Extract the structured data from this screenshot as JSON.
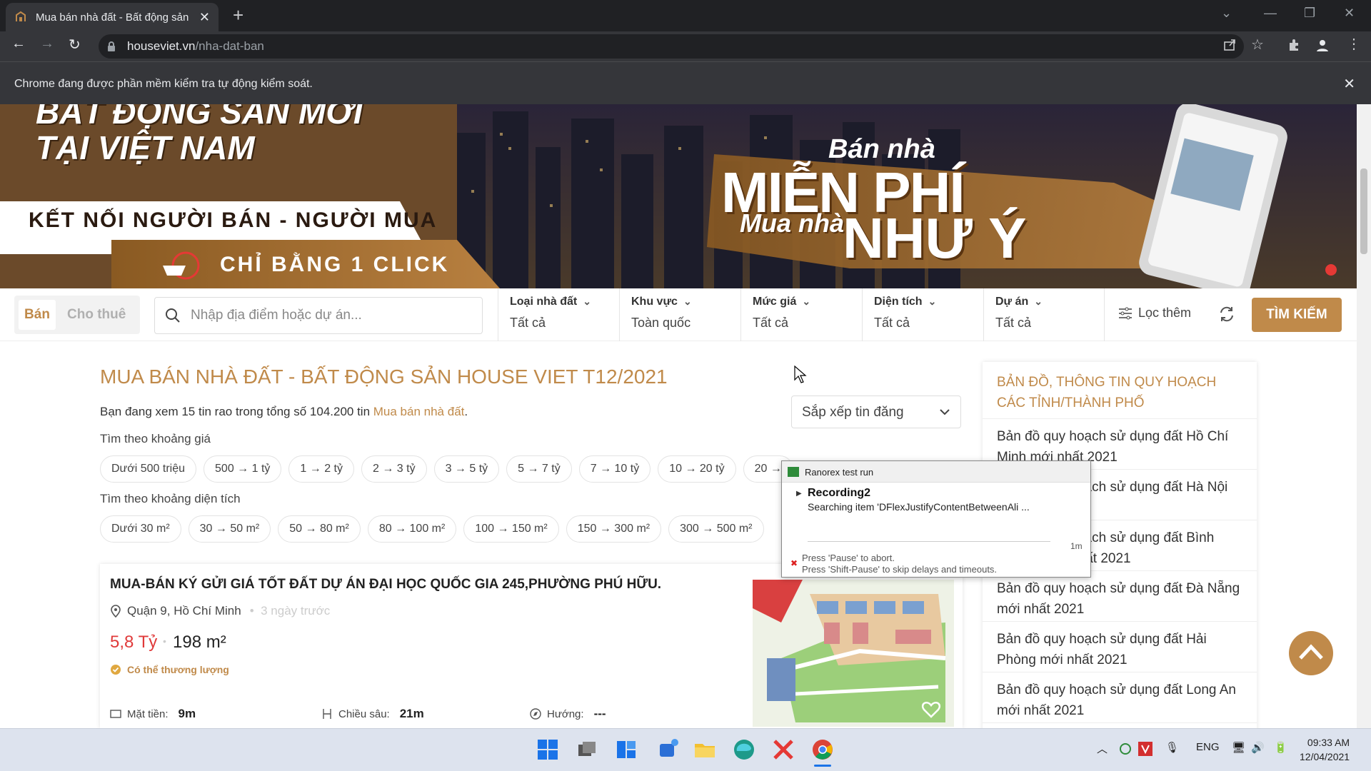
{
  "browser": {
    "tab_title": "Mua bán nhà đất - Bất động sản",
    "url_domain": "houseviet.vn",
    "url_path": "/nha-dat-ban",
    "automation_notice": "Chrome đang được phần mềm kiểm tra tự động kiểm soát."
  },
  "banner": {
    "line1": "BẤT ĐỘNG SẢN MỚI",
    "line2": "TẠI VIỆT NAM",
    "tagline": "KẾT NỐI NGƯỜI BÁN - NGƯỜI MUA",
    "click_text": "CHỈ BẰNG 1 CLICK",
    "ban_nha": "Bán nhà",
    "mien_phi": "MIỄN PHÍ",
    "mua_nha": "Mua nhà",
    "nhu_y": "NHƯ Ý"
  },
  "search": {
    "tab_sell": "Bán",
    "tab_rent": "Cho thuê",
    "placeholder": "Nhập địa điểm hoặc dự án...",
    "filters": [
      {
        "label": "Loại nhà đất",
        "value": "Tất cả"
      },
      {
        "label": "Khu vực",
        "value": "Toàn quốc"
      },
      {
        "label": "Mức giá",
        "value": "Tất cả"
      },
      {
        "label": "Diện tích",
        "value": "Tất cả"
      },
      {
        "label": "Dự án",
        "value": "Tất cả"
      }
    ],
    "more_filters": "Lọc thêm",
    "search_button": "TÌM KIẾM"
  },
  "main": {
    "title": "MUA BÁN NHÀ ĐẤT - BẤT ĐỘNG SẢN HOUSE VIET T12/2021",
    "summary_prefix": "Bạn đang xem 15 tin rao trong tổng số 104.200 tin ",
    "summary_link": "Mua bán nhà đất",
    "summary_suffix": ".",
    "sort_label": "Sắp xếp tin đăng",
    "price_label": "Tìm theo khoảng giá",
    "price_ranges": [
      "Dưới 500 triệu",
      "500 → 1 tỷ",
      "1 → 2 tỷ",
      "2 → 3 tỷ",
      "3 → 5 tỷ",
      "5 → 7 tỷ",
      "7 → 10 tỷ",
      "10 → 20 tỷ",
      "20 →"
    ],
    "area_label": "Tìm theo khoảng diện tích",
    "area_ranges": [
      "Dưới 30 m²",
      "30 → 50 m²",
      "50 → 80 m²",
      "80 → 100 m²",
      "100 → 150 m²",
      "150 → 300 m²",
      "300 → 500 m²"
    ]
  },
  "listing": {
    "title": "MUA-BÁN KÝ GỬI GIÁ TỐT ĐẤT DỰ ÁN ĐẠI HỌC QUỐC GIA 245,PHƯỜNG PHÚ HỮU.",
    "location": "Quận 9, Hồ Chí Minh",
    "posted": "3 ngày trước",
    "price": "5,8 Tỷ",
    "area": "198 m²",
    "negotiable": "Có thể thương lượng",
    "frontage_label": "Mặt tiền:",
    "frontage_value": "9m",
    "depth_label": "Chiều sâu:",
    "depth_value": "21m",
    "direction_label": "Hướng:",
    "direction_value": "---"
  },
  "sidebar": {
    "heading": "BẢN ĐỒ, THÔNG TIN QUY HOẠCH CÁC TỈNH/THÀNH PHỐ",
    "items": [
      "Bản đồ quy hoạch sử dụng đất Hồ Chí Minh mới nhất 2021",
      "Bản đồ quy hoạch sử dụng đất Hà Nội mới nhất 2021",
      "Bản đồ quy hoạch sử dụng đất Bình Dương mới nhất 2021",
      "Bản đồ quy hoạch sử dụng đất Đà Nẵng mới nhất 2021",
      "Bản đồ quy hoạch sử dụng đất Hải Phòng mới nhất 2021",
      "Bản đồ quy hoạch sử dụng đất Long An mới nhất 2021"
    ]
  },
  "ranorex": {
    "window_title": "Ranorex test run",
    "recording": "Recording2",
    "status": "Searching item 'DFlexJustifyContentBetweenAli ...",
    "time": "1m",
    "msg_pause": "Press 'Pause' to abort.",
    "msg_shift": "Press 'Shift-Pause' to skip delays and timeouts."
  },
  "taskbar": {
    "lang": "ENG",
    "time": "09:33 AM",
    "date": "12/04/2021"
  },
  "colors": {
    "accent": "#c08a4a",
    "price": "#e03a3a"
  }
}
